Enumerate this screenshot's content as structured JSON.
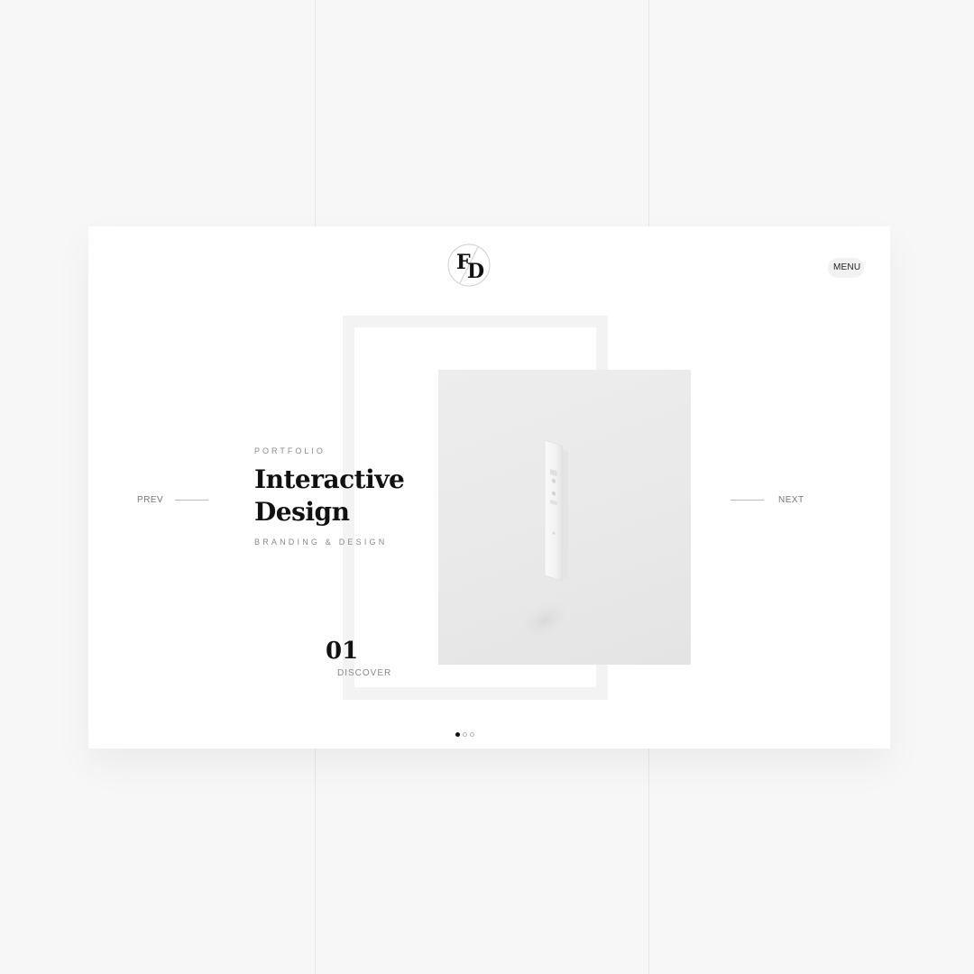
{
  "header": {
    "logo_alt": "FD",
    "menu_label": "MENU"
  },
  "slide": {
    "eyebrow": "PORTFOLIO",
    "title_line1": "Interactive",
    "title_line2": "Design",
    "subtitle": "BRANDING & DESIGN",
    "number": "01",
    "cta": "DISCOVER"
  },
  "nav": {
    "prev_label": "PREV",
    "next_label": "NEXT"
  },
  "pagination": {
    "total": 3,
    "active_index": 0
  },
  "colors": {
    "background": "#f7f7f7",
    "card": "#ffffff",
    "text_dark": "#111111",
    "text_muted": "#8a8a8a",
    "frame": "#f3f3f3"
  }
}
